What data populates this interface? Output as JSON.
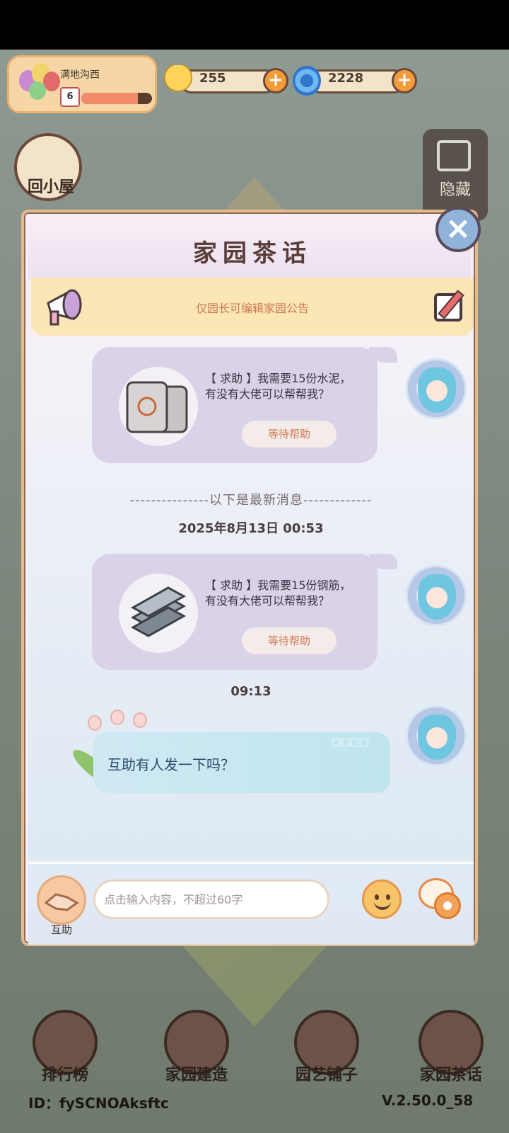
{
  "player": {
    "name": "满地沟西",
    "level": "6",
    "level_progress": 0.8
  },
  "currencies": [
    {
      "icon": "snail-icon",
      "value": "255"
    },
    {
      "icon": "swirl-icon",
      "value": "2228"
    }
  ],
  "left_buttons": {
    "home_label": "回小屋"
  },
  "hide_button": {
    "label": "隐藏"
  },
  "dialog": {
    "title": "家园茶话",
    "notice": "仅园长可编辑家园公告"
  },
  "messages": [
    {
      "line1": "【 求助 】我需要15份水泥，",
      "line2": "有没有大佬可以帮帮我？",
      "button": "等待帮助",
      "item_icon": "cement-bag-icon"
    },
    {
      "line1": "【 求助 】我需要15份钢筋，",
      "line2": "有没有大佬可以帮帮我？",
      "button": "等待帮助",
      "item_icon": "steel-bar-icon"
    }
  ],
  "divider": "---------------以下是最新消息-------------",
  "timestamps": [
    "2025年8月13日 00:53",
    "09:13"
  ],
  "chat_message": {
    "text": "互助有人发一下吗？",
    "tag": "□□□□"
  },
  "input_bar": {
    "mutual_label": "互助",
    "placeholder": "点击输入内容，不超过60字"
  },
  "bottom_nav": [
    {
      "label": "排行榜"
    },
    {
      "label": "家园建造"
    },
    {
      "label": "园艺铺子"
    },
    {
      "label": "家园茶话"
    }
  ],
  "footer": {
    "id": "ID：fySCNOAksftc",
    "version": "V.2.50.0_58"
  },
  "colors": {
    "accent": "#f39a3a",
    "dialog_border": "#e7b98e",
    "bubble": "#d9d2e8"
  }
}
